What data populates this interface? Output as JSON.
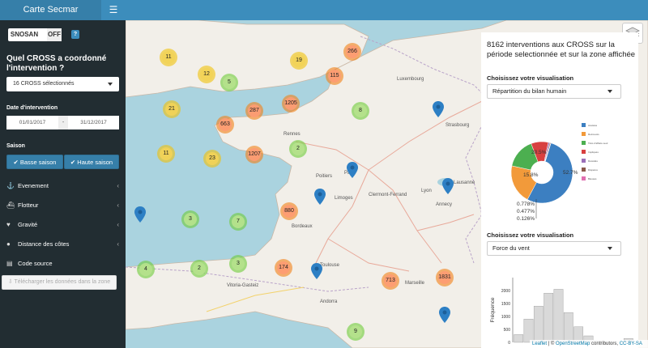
{
  "header": {
    "brand": "Carte Secmar",
    "menu_icon": "hamburger-icon"
  },
  "sidebar": {
    "toggle_on": "SNOSAN",
    "toggle_off": "OFF",
    "help": "?",
    "cross_question": "Quel CROSS a coordonné l'intervention ?",
    "cross_select": "16 CROSS sélectionnés",
    "date_label": "Date d'intervention",
    "date_start": "01/01/2017",
    "date_sep": "-",
    "date_end": "31/12/2017",
    "season_label": "Saison",
    "season_low": "✔ Basse saison",
    "season_high": "✔ Haute saison",
    "menu": [
      {
        "label": "Evenement",
        "icon": "anchor-icon"
      },
      {
        "label": "Flotteur",
        "icon": "ship-icon"
      },
      {
        "label": "Gravité",
        "icon": "heartbeat-icon"
      },
      {
        "label": "Distance des côtes",
        "icon": "globe-icon"
      },
      {
        "label": "Code source",
        "icon": "file-icon"
      }
    ],
    "download": "⇩ Télécharger les données dans la zone"
  },
  "map": {
    "clusters": [
      "11",
      "12",
      "19",
      "266",
      "5",
      "115",
      "21",
      "287",
      "1205",
      "8",
      "663",
      "2",
      "11",
      "1207",
      "23",
      "880",
      "3",
      "7",
      "4",
      "2",
      "3",
      "174",
      "713",
      "1831",
      "9"
    ],
    "places": [
      "Luxembourg",
      "Strasbourg",
      "Rennes",
      "Paris",
      "Poitiers",
      "Limoges",
      "Clermont-Ferrand",
      "Lyon",
      "Bordeaux",
      "Toulouse",
      "Marseille",
      "Lausanne",
      "Annecy",
      "Vitoria-Gasteiz",
      "Andorra"
    ]
  },
  "panel": {
    "title": "8162 interventions aux CROSS sur la période selectionnée et sur la zone affichée",
    "viz_label_1": "Choisissez votre visualisation",
    "viz_select_1": "Répartition du bilan humain",
    "viz_label_2": "Choisissez votre visualisation",
    "viz_select_2": "Force du vent"
  },
  "attribution": {
    "leaflet": "Leaflet",
    "rest": " | © ",
    "osm": "OpenStreetMap",
    "contrib": " contributors, ",
    "license": "CC-BY-SA"
  },
  "chart_data": [
    {
      "type": "pie",
      "slice_labels": [
        "52.7%",
        "20.5%",
        "15.8%",
        "0.778%",
        "0.477%",
        "0.126%"
      ],
      "values": [
        52.7,
        20.5,
        15.8,
        9.0,
        0.778,
        0.477,
        0.126
      ],
      "colors": [
        "#3c7fc1",
        "#f29a3a",
        "#4caf50",
        "#d84040",
        "#9b6fb8",
        "#8b5a4a",
        "#e06fb0"
      ],
      "legend": [
        "Assistés",
        "Retrouvés",
        "Tirés d'affaire seul",
        "Impliqués",
        "Décédés",
        "Disparus",
        "Blessés"
      ],
      "legend_placement": "right"
    },
    {
      "type": "bar",
      "ylabel": "Fréquence",
      "ylim": [
        0,
        2500
      ],
      "yticks": [
        "2000",
        "1500",
        "1000",
        "500",
        "0"
      ],
      "values": [
        300,
        900,
        1400,
        1900,
        2050,
        1150,
        600,
        250,
        60,
        10,
        5,
        150
      ]
    }
  ]
}
